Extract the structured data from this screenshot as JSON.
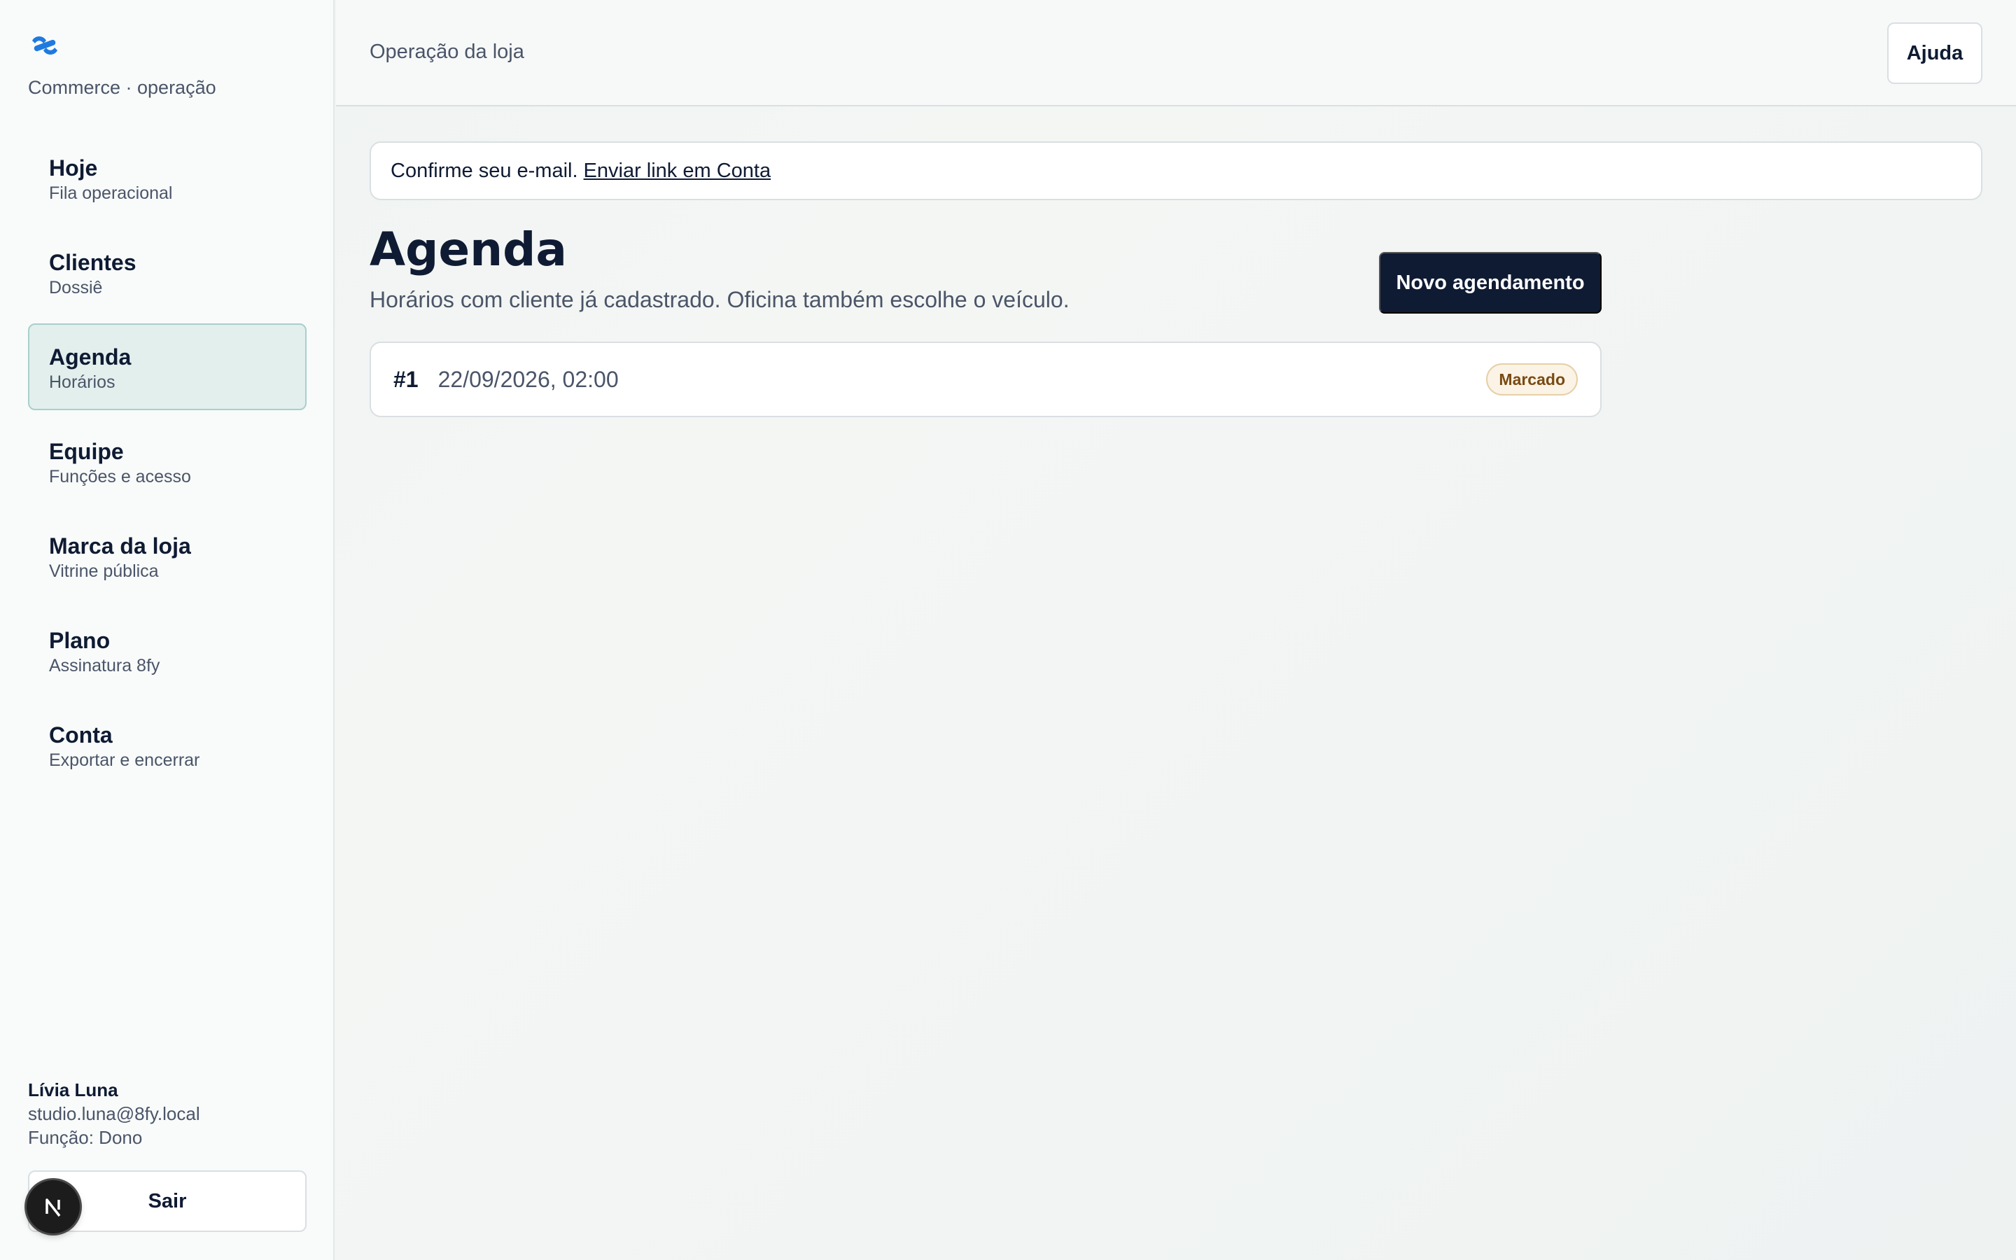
{
  "brand": {
    "logo_icon": "8fy-logo-icon",
    "subtitle": "Commerce · operação",
    "accent": "#1f7ae0"
  },
  "sidebar": {
    "items": [
      {
        "label": "Hoje",
        "sublabel": "Fila operacional",
        "active": false
      },
      {
        "label": "Clientes",
        "sublabel": "Dossiê",
        "active": false
      },
      {
        "label": "Agenda",
        "sublabel": "Horários",
        "active": true
      },
      {
        "label": "Equipe",
        "sublabel": "Funções e acesso",
        "active": false
      },
      {
        "label": "Marca da loja",
        "sublabel": "Vitrine pública",
        "active": false
      },
      {
        "label": "Plano",
        "sublabel": "Assinatura 8fy",
        "active": false
      },
      {
        "label": "Conta",
        "sublabel": "Exportar e encerrar",
        "active": false
      }
    ],
    "user": {
      "name": "Lívia Luna",
      "email": "studio.luna@8fy.local",
      "role": "Função: Dono"
    },
    "logout_label": "Sair"
  },
  "header": {
    "title": "Operação da loja",
    "help_label": "Ajuda"
  },
  "notice": {
    "text": "Confirme seu e-mail.",
    "link": "Enviar link em Conta"
  },
  "main": {
    "title": "Agenda",
    "subtitle": "Horários com cliente já cadastrado. Oficina também escolhe o veículo.",
    "new_button": "Novo agendamento",
    "appointments": [
      {
        "number": "#1",
        "datetime": "22/09/2026, 02:00",
        "status": "Marcado"
      }
    ]
  },
  "colors": {
    "primary_dark": "#0f1b33",
    "active_nav_bg": "#e2efed",
    "status_bg": "#fbf3e6",
    "status_text": "#7a4a12"
  },
  "dev_badge_icon": "nextjs-icon"
}
